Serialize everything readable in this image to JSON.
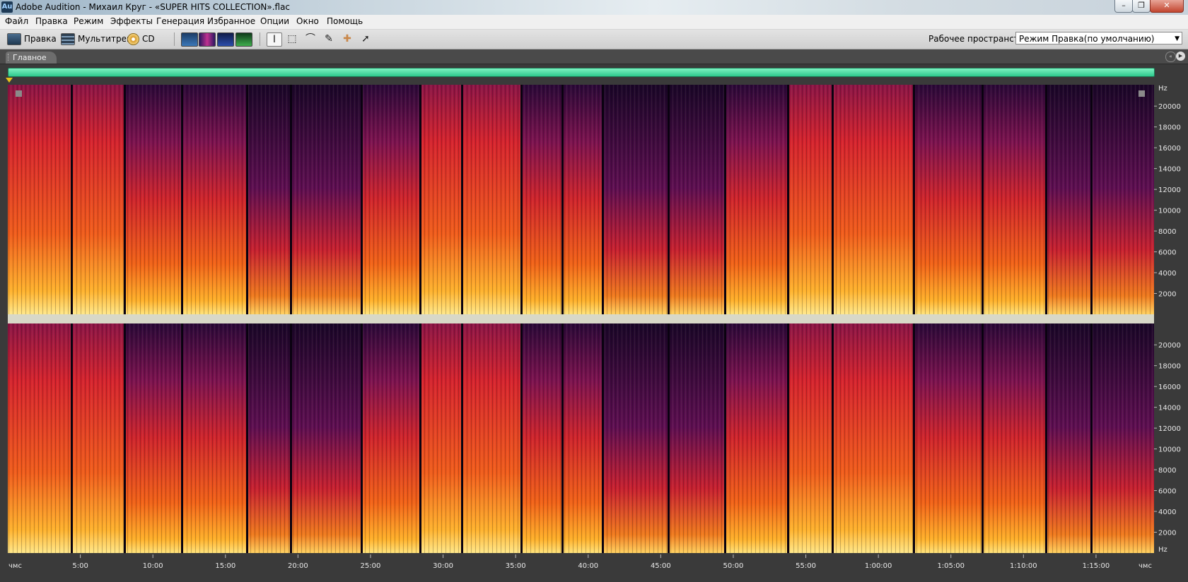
{
  "window": {
    "app_icon": "Au",
    "title": "Adobe Audition - Михаил Круг - «SUPER HITS COLLECTION».flac",
    "minimize_glyph": "–",
    "maximize_glyph": "❐",
    "close_glyph": "✕"
  },
  "menu": [
    "Файл",
    "Правка",
    "Режим",
    "Эффекты",
    "Генерация",
    "Избранное",
    "Опции",
    "Окно",
    "Помощь"
  ],
  "toolbar": {
    "modes": {
      "edit": "Правка",
      "multitrack": "Мультитрек",
      "cd": "CD"
    },
    "tool_glyphs": {
      "time_selection": "I",
      "marquee": "⬚",
      "lasso": "⌒",
      "brush": "✎",
      "healing": "✚",
      "move": "➚"
    },
    "workspace_label": "Рабочее пространство:",
    "workspace_value": "Режим Правка(по умолчанию)"
  },
  "panel": {
    "tab": "Главное",
    "menu_glyph": "«",
    "options_glyph": "▶"
  },
  "channels": {
    "count": 2,
    "freq_unit": "Hz",
    "freq_ticks": [
      20000,
      18000,
      16000,
      14000,
      12000,
      10000,
      8000,
      6000,
      4000,
      2000
    ],
    "freq_max": 22050
  },
  "timeline": {
    "start_label": "чмс",
    "end_label": "чмс",
    "ticks": [
      "5:00",
      "10:00",
      "15:00",
      "20:00",
      "25:00",
      "30:00",
      "35:00",
      "40:00",
      "45:00",
      "50:00",
      "55:00",
      "1:00:00",
      "1:05:00",
      "1:10:00",
      "1:15:00"
    ],
    "total_minutes": 79
  },
  "colors": {
    "spectral_low": "#1a0628",
    "spectral_mid": "#c81e2a",
    "spectral_high": "#ffe070",
    "overview": "#35d99a"
  },
  "icons": {
    "app": "audition-logo-icon",
    "edit_mode": "waveform-mode-icon",
    "multitrack_mode": "multitrack-icon",
    "cd_mode": "cd-disc-icon"
  }
}
